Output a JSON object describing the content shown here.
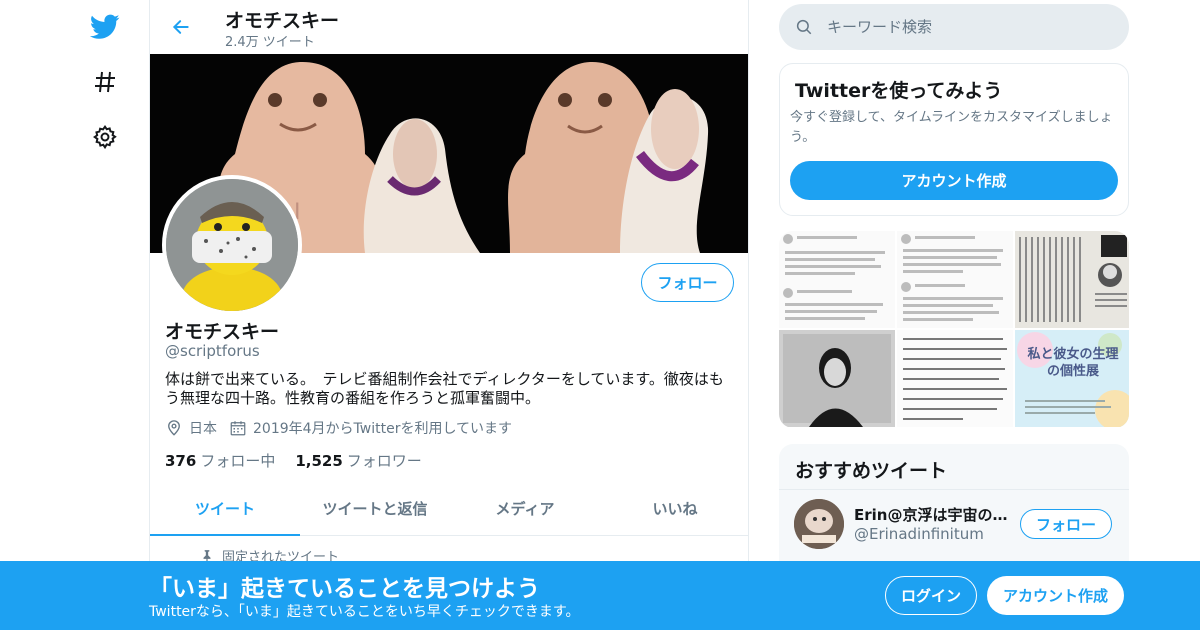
{
  "colors": {
    "accent": "#1da1f2",
    "text_primary": "#14171a",
    "text_secondary": "#657786",
    "border": "#e6ecf0"
  },
  "nav": {
    "icons": [
      "twitter-logo-icon",
      "hashtag-icon",
      "gear-icon"
    ]
  },
  "header": {
    "name": "オモチスキー",
    "tweet_count": "2.4万 ツイート"
  },
  "profile": {
    "follow_label": "フォロー",
    "name": "オモチスキー",
    "handle": "@scriptforus",
    "bio": "体は餅で出来ている。　テレビ番組制作会社でディレクターをしています。徹夜はもう無理な四十路。性教育の番組を作ろうと孤軍奮闘中。",
    "location": "日本",
    "joined": "2019年4月からTwitterを利用しています",
    "following_count": "376",
    "following_label": "フォロー中",
    "followers_count": "1,525",
    "followers_label": "フォロワー"
  },
  "tabs": [
    {
      "label": "ツイート",
      "active": true
    },
    {
      "label": "ツイートと返信",
      "active": false
    },
    {
      "label": "メディア",
      "active": false
    },
    {
      "label": "いいね",
      "active": false
    }
  ],
  "pinned_label": "固定されたツイート",
  "search": {
    "placeholder": "キーワード検索"
  },
  "signup_card": {
    "title": "Twitterを使ってみよう",
    "description": "今すぐ登録して、タイムラインをカスタマイズしましょう。",
    "button": "アカウント作成"
  },
  "media": {
    "cells": [
      "tweet-screenshot",
      "tweet-screenshot",
      "newspaper-column",
      "portrait-photo",
      "magazine-text",
      "event-poster"
    ],
    "poster_text": "私と彼女の生理の個性展"
  },
  "recommended": {
    "title": "おすすめツイート",
    "user_name": "Erin@京浮は宇宙の…",
    "user_handle": "@Erinadinfinitum",
    "follow_label": "フォロー"
  },
  "bottom_bar": {
    "title": "「いま」起きていることを見つけよう",
    "subtitle": "Twitterなら、「いま」起きていることをいち早くチェックできます。",
    "login_label": "ログイン",
    "signup_label": "アカウント作成"
  }
}
